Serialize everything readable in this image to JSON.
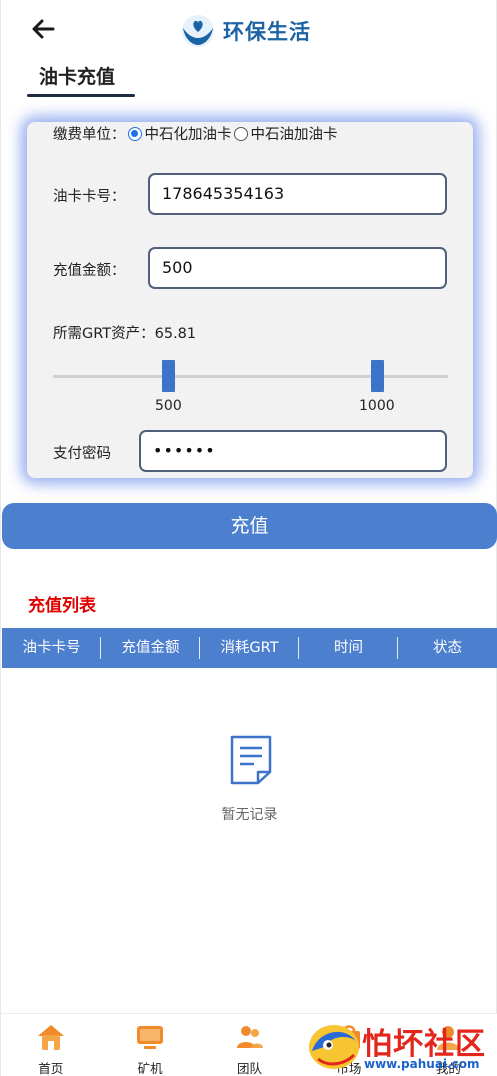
{
  "header": {
    "title": "环保生活",
    "back_icon": "arrow-left-icon",
    "logo_icon": "hands-heart-logo-icon"
  },
  "section": {
    "title": "油卡充值"
  },
  "form": {
    "unit_label": "缴费单位：",
    "unit_options": [
      {
        "label": "中石化加油卡",
        "checked": true
      },
      {
        "label": "中石油加油卡",
        "checked": false
      }
    ],
    "card_label": "油卡卡号：",
    "card_value": "178645354163",
    "amount_label": "充值金额：",
    "amount_value": "500",
    "grt_label": "所需GRT资产：",
    "grt_value": "65.81",
    "slider_options": [
      "500",
      "1000"
    ],
    "password_label": "支付密码",
    "password_value": "••••••"
  },
  "submit_label": "充值",
  "list": {
    "title": "充值列表",
    "columns": [
      "油卡卡号",
      "充值金额",
      "消耗GRT",
      "时间",
      "状态"
    ],
    "empty_text": "暂无记录",
    "empty_icon": "document-icon"
  },
  "nav": [
    {
      "label": "首页",
      "icon": "home-icon"
    },
    {
      "label": "矿机",
      "icon": "monitor-icon"
    },
    {
      "label": "团队",
      "icon": "team-icon"
    },
    {
      "label": "市场",
      "icon": "market-icon"
    },
    {
      "label": "我的",
      "icon": "user-icon"
    }
  ],
  "watermark": {
    "text": "怕坏社区",
    "url": "www.pahuai.com"
  },
  "colors": {
    "primary": "#4c7fce",
    "brand": "#1c63a6",
    "accent_red": "#e00000"
  }
}
